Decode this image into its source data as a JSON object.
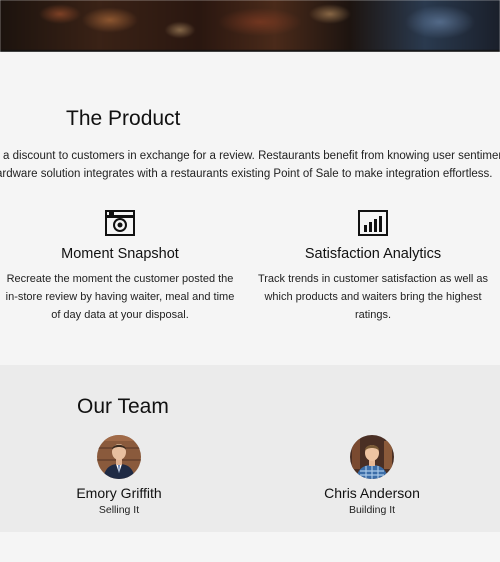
{
  "product": {
    "title": "The Product",
    "intro_lines": [
      "r a discount to customers in exchange for a review. Restaurants benefit from knowing user sentiment,",
      "ardware solution integrates with a restaurants existing Point of Sale to make integration effortless."
    ],
    "features": [
      {
        "icon": "camera-icon",
        "title": "Moment Snapshot",
        "description_lines": [
          "Recreate the moment the customer posted the",
          "in-store review by having waiter, meal and time",
          "of day data at your disposal."
        ]
      },
      {
        "icon": "bar-chart-icon",
        "title": "Satisfaction Analytics",
        "description_lines": [
          "Track trends in customer satisfaction as well as",
          "which products and waiters bring the highest",
          "ratings."
        ]
      }
    ]
  },
  "team": {
    "title": "Our Team",
    "members": [
      {
        "name": "Emory Griffith",
        "role": "Selling It"
      },
      {
        "name": "Chris Anderson",
        "role": "Building It"
      }
    ]
  }
}
